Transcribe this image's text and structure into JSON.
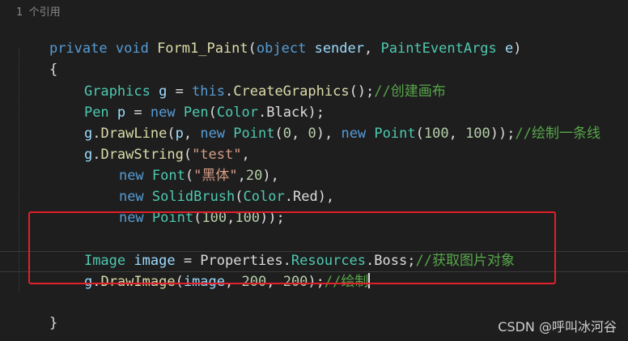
{
  "codelens": "1 个引用",
  "lines": [
    {
      "kw1": "private",
      "kw2": "void",
      "fn": "Form1_Paint",
      "open": "(",
      "t1": "object",
      "p1": "sender",
      "comma": ", ",
      "t2": "PaintEventArgs",
      "p2": "e",
      "close": ")"
    },
    {
      "text": "{"
    },
    {
      "type": "Graphics",
      "var": "g",
      "eq": " = ",
      "kw": "this",
      "dot": ".",
      "fn": "CreateGraphics",
      "tail": "();",
      "comment": "//创建画布"
    },
    {
      "type": "Pen",
      "var": "p",
      "eq": " = ",
      "kw": "new",
      "type2": "Pen",
      "open": "(",
      "type3": "Color",
      "dot": ".",
      "member": "Black",
      "tail": ");"
    },
    {
      "obj": "g",
      "dot": ".",
      "fn": "DrawLine",
      "open": "(",
      "arg": "p",
      "comma": ", ",
      "kw1": "new",
      "t1": "Point",
      "o1": "(",
      "n1": "0",
      "c1": ", ",
      "n2": "0",
      "cl1": ")",
      "comma2": ", ",
      "kw2": "new",
      "t2": "Point",
      "o2": "(",
      "n3": "100",
      "c2": ", ",
      "n4": "100",
      "tail": "));",
      "comment": "//绘制一条线"
    },
    {
      "obj": "g",
      "dot": ".",
      "fn": "DrawString",
      "open": "(",
      "str": "\"test\"",
      "tail": ","
    },
    {
      "kw": "new",
      "type": "Font",
      "open": "(",
      "str": "\"黑体\"",
      "comma": ",",
      "num": "20",
      "tail": "),"
    },
    {
      "kw": "new",
      "type": "SolidBrush",
      "open": "(",
      "type2": "Color",
      "dot": ".",
      "member": "Red",
      "tail": "),"
    },
    {
      "kw": "new",
      "type": "Point",
      "open": "(",
      "n1": "100",
      "comma": ",",
      "n2": "100",
      "tail": "));"
    },
    {
      "type": "Image",
      "var": "image",
      "eq": " = ",
      "ns1": "Properties",
      "dot1": ".",
      "ns2": "Resources",
      "dot2": ".",
      "member": "Boss",
      "tail": ";",
      "comment": "//获取图片对象"
    },
    {
      "obj": "g",
      "dot": ".",
      "fn": "DrawImage",
      "open": "(",
      "arg": "image",
      "comma": ", ",
      "n1": "200",
      "c2": ", ",
      "n2": "200",
      "tail": ");",
      "comment": "//绘制"
    },
    {
      "text": "}"
    }
  ],
  "watermark": "CSDN @呼叫冰河谷",
  "colors": {
    "background": "#1e1e1e",
    "keyword": "#569cd6",
    "type": "#4ec9b0",
    "method": "#dcdcaa",
    "variable": "#9cdcfe",
    "string": "#d69d85",
    "number": "#b5cea8",
    "comment": "#57a64a",
    "highlight_box": "#e0202a"
  }
}
